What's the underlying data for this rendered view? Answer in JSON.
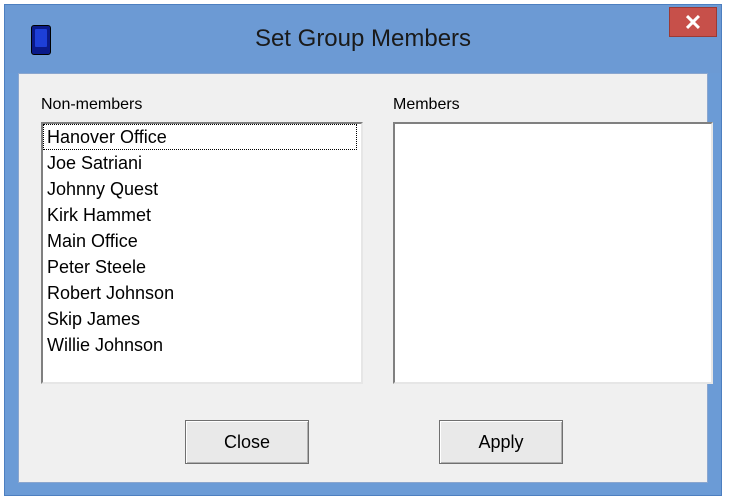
{
  "window": {
    "title": "Set Group Members",
    "close_glyph": "✕",
    "app_icon": "device-icon"
  },
  "non_members": {
    "label": "Non-members",
    "items": [
      "Hanover Office",
      "Joe Satriani",
      "Johnny Quest",
      "Kirk Hammet",
      "Main Office",
      "Peter Steele",
      "Robert Johnson",
      "Skip James",
      "Willie Johnson"
    ],
    "focused_index": 0
  },
  "members": {
    "label": "Members",
    "items": []
  },
  "buttons": {
    "close": "Close",
    "apply": "Apply"
  },
  "colors": {
    "titlebar": "#6c9ad4",
    "close_button": "#c7504a",
    "client_bg": "#f0f0f0"
  }
}
